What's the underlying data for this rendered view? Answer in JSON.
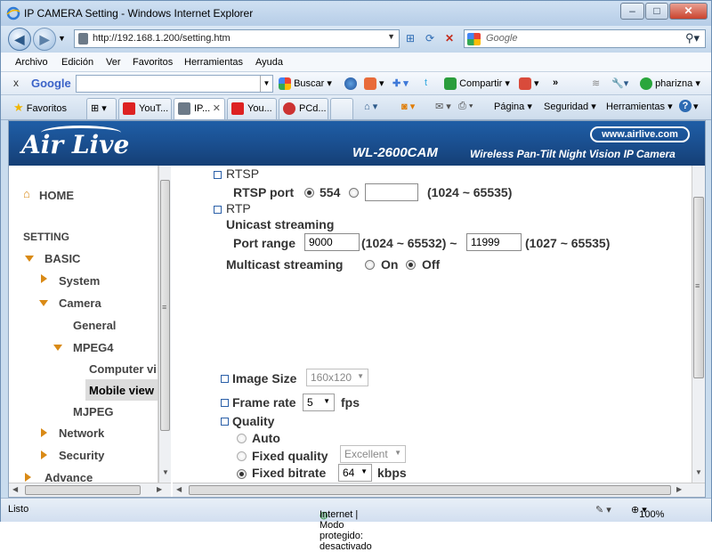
{
  "window": {
    "title": "IP CAMERA Setting - Windows Internet Explorer",
    "minimize": "–",
    "maximize": "□",
    "close": "✕"
  },
  "address": {
    "url": "http://192.168.1.200/setting.htm",
    "search_placeholder": "Google"
  },
  "menu": [
    "Archivo",
    "Edición",
    "Ver",
    "Favoritos",
    "Herramientas",
    "Ayuda"
  ],
  "google_bar": {
    "logo": "Google",
    "search_label": "Buscar",
    "share_label": "Compartir",
    "user": "pharizna"
  },
  "tabs": {
    "favorites_label": "Favoritos",
    "items": [
      {
        "label": "YouT...",
        "active": false
      },
      {
        "label": "IP...",
        "active": true
      },
      {
        "label": "You...",
        "active": false
      },
      {
        "label": "PCd...",
        "active": false
      }
    ]
  },
  "toolbar": {
    "page": "Página",
    "security": "Seguridad",
    "tools": "Herramientas"
  },
  "banner": {
    "logo": "Air Live",
    "website": "www.airlive.com",
    "model": "WL-2600CAM",
    "tagline": "Wireless Pan-Tilt Night Vision IP Camera"
  },
  "sidebar": {
    "home": "HOME",
    "setting": "SETTING",
    "basic": "BASIC",
    "system": "System",
    "camera": "Camera",
    "general": "General",
    "mpeg4": "MPEG4",
    "computer_view": "Computer vi",
    "mobile_view": "Mobile view",
    "mjpeg": "MJPEG",
    "network": "Network",
    "security": "Security",
    "advance": "Advance"
  },
  "form": {
    "rtsp": "RTSP",
    "rtsp_port_label": "RTSP port",
    "rtsp_port_default": "554",
    "rtsp_custom_value": "",
    "rtsp_range": "(1024 ~ 65535)",
    "rtp": "RTP",
    "unicast": "Unicast streaming",
    "port_range_label": "Port range",
    "port_from": "9000",
    "port_from_range": "(1024 ~ 65532) ~",
    "port_to": "11999",
    "port_to_range": "(1027 ~ 65535)",
    "multicast": "Multicast streaming",
    "on": "On",
    "off": "Off",
    "image_size_label": "Image Size",
    "image_size_value": "160x120",
    "frame_rate_label": "Frame rate",
    "frame_rate_value": "5",
    "fps": "fps",
    "quality_label": "Quality",
    "auto": "Auto",
    "fixed_quality": "Fixed quality",
    "fixed_quality_value": "Excellent",
    "fixed_bitrate": "Fixed bitrate",
    "bitrate_value": "64",
    "kbps": "kbps"
  },
  "status": {
    "text": "Listo",
    "zone": "Internet | Modo protegido: desactivado",
    "zoom": "100%"
  }
}
